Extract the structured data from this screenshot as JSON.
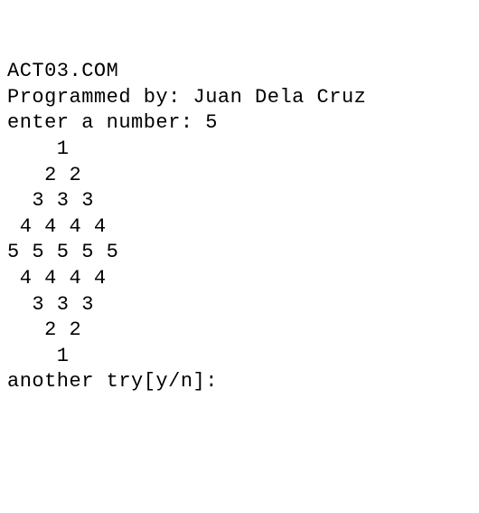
{
  "lines": {
    "title": "ACT03.COM",
    "author": "Programmed by: Juan Dela Cruz",
    "blank1": "",
    "prompt": "enter a number: 5",
    "blank2": "",
    "row1": "    1",
    "row2": "   2 2",
    "row3": "  3 3 3",
    "row4": " 4 4 4 4",
    "row5": "5 5 5 5 5",
    "row6": " 4 4 4 4",
    "row7": "  3 3 3",
    "row8": "   2 2",
    "row9": "    1",
    "blank3": "",
    "tryagain": "another try[y/n]:"
  }
}
